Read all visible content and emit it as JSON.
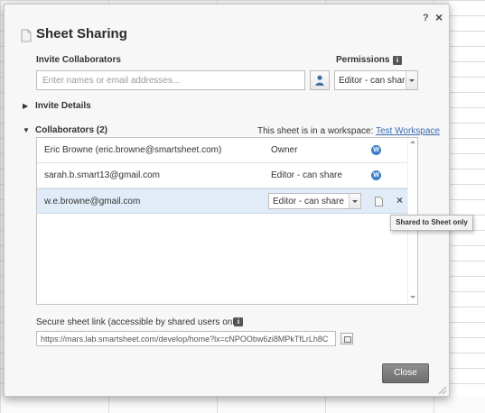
{
  "dialog": {
    "title": "Sheet Sharing",
    "help_label": "?",
    "close_label": "×"
  },
  "invite": {
    "label": "Invite Collaborators",
    "placeholder": "Enter names or email addresses...",
    "permissions_label": "Permissions",
    "permissions_info": "i",
    "permissions_value": "Editor - can share"
  },
  "invite_details": {
    "label": "Invite Details"
  },
  "collaborators": {
    "label": "Collaborators (2)",
    "workspace_text": "This sheet is in a workspace:",
    "workspace_link": "Test Workspace",
    "rows": [
      {
        "name": "Eric Browne (eric.browne@smartsheet.com)",
        "permission": "Owner",
        "ws_badge": "W"
      },
      {
        "name": "sarah.b.smart13@gmail.com",
        "permission": "Editor - can share",
        "ws_badge": "W"
      },
      {
        "name": "w.e.browne@gmail.com",
        "permission": "Editor - can share",
        "remove_label": "×"
      }
    ],
    "tooltip": "Shared to Sheet only"
  },
  "link": {
    "label": "Secure sheet link (accessible by shared users only)",
    "info": "i",
    "value": "https://mars.lab.smartsheet.com/develop/home?lx=cNPOObw6zi8MPkTfLrLh8C"
  },
  "footer": {
    "close_label": "Close"
  },
  "colors": {
    "accent_blue": "#3f7fc7",
    "link_blue": "#3b6db6",
    "selected_row": "#e1ecf8",
    "close_button": "#7a7a7a"
  },
  "icons": {
    "title": "sheet-document-icon",
    "contacts": "person-contacts-icon",
    "workspace": "workspace-badge-icon",
    "row_sheet": "sheet-document-icon",
    "copy": "copy-icon"
  }
}
